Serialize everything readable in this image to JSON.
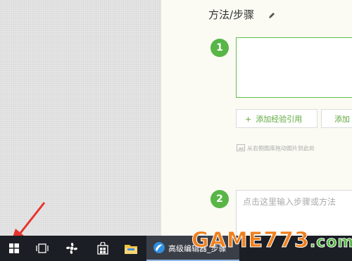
{
  "section": {
    "title": "方法/步骤"
  },
  "steps": [
    {
      "number": "1"
    },
    {
      "number": "2",
      "placeholder": "点击这里输入步骤或方法"
    }
  ],
  "buttons": {
    "add_experience_ref": "添加经验引用",
    "add_more": "添加"
  },
  "hint": "从右侧图库拖动图片到此处",
  "taskbar": {
    "app_label": "高级编辑器_步骤"
  },
  "watermark": {
    "main": "GAME773",
    "suffix": ".com"
  },
  "colors": {
    "accent_green": "#57b646",
    "taskbar_bg": "#1b1e24",
    "watermark_orange": "#f07f1b"
  }
}
